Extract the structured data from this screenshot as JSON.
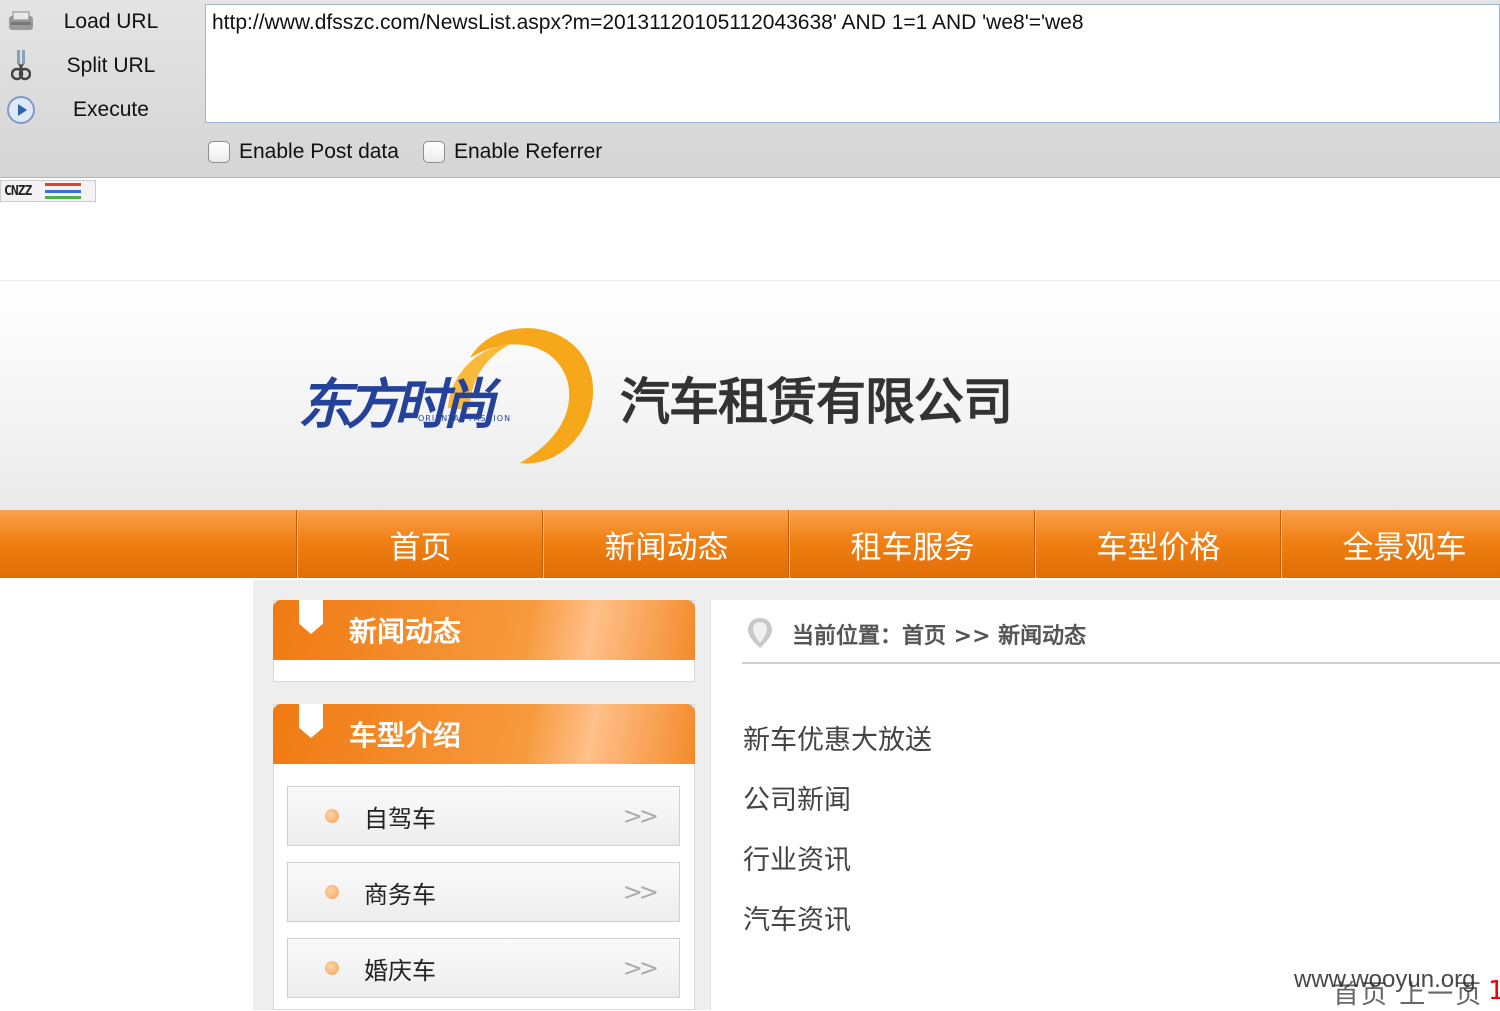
{
  "hackbar": {
    "load_url": "Load URL",
    "split_url": "Split URL",
    "execute": "Execute",
    "url_value": "http://www.dfsszc.com/NewsList.aspx?m=20131120105112043638' AND 1=1 AND 'we8'='we8",
    "enable_post": "Enable Post data",
    "enable_referrer": "Enable Referrer",
    "icons": [
      "load-url-icon",
      "split-url-icon",
      "execute-icon"
    ]
  },
  "cnzz": {
    "label": "CNZZ",
    "bar_colors": [
      "#d9443a",
      "#3d6fd8",
      "#49b04a"
    ]
  },
  "header": {
    "logo_cn": "东方时尚",
    "logo_en": "ORIENTAL FASHION",
    "company": "汽车租赁有限公司",
    "logo_ring_color": "#f6a81a",
    "logo_text_color": "#25429a"
  },
  "nav": {
    "items": [
      "首页",
      "新闻动态",
      "租车服务",
      "车型价格",
      "全景观车"
    ],
    "color": "#f08014"
  },
  "sidebar": {
    "news_title": "新闻动态",
    "models_title": "车型介绍",
    "models": [
      "自驾车",
      "商务车",
      "婚庆车"
    ],
    "arrow": ">>"
  },
  "main": {
    "breadcrumb": "当前位置：首页 >> 新闻动态",
    "news_links": [
      "新车优惠大放送",
      "公司新闻",
      "行业资讯",
      "汽车资讯"
    ]
  },
  "pager": {
    "text": "首页 上一页",
    "current": "1"
  },
  "watermark": "www.wooyun.org"
}
